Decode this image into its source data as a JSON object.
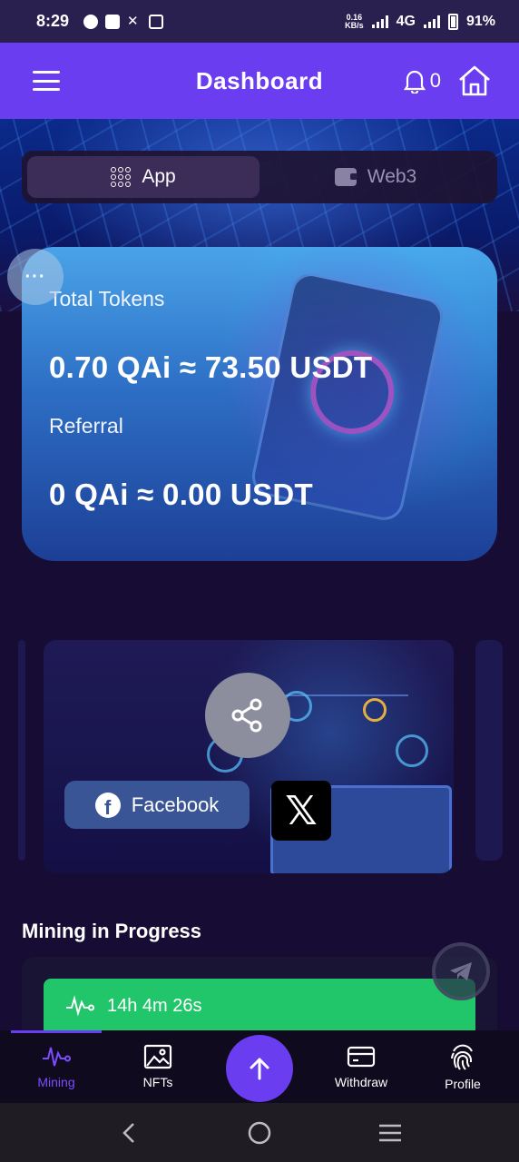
{
  "status_bar": {
    "time": "8:29",
    "net_speed_value": "0.16",
    "net_speed_unit": "KB/s",
    "network": "4G",
    "battery": "91%"
  },
  "app_bar": {
    "title": "Dashboard",
    "notification_count": "0"
  },
  "mode_tabs": [
    {
      "label": "App",
      "icon": "grid-icon",
      "active": true
    },
    {
      "label": "Web3",
      "icon": "wallet-icon",
      "active": false
    }
  ],
  "floating_menu": {
    "label": "···"
  },
  "tokens_card": {
    "total_label": "Total Tokens",
    "total_value": "0.70 QAi ≈ 73.50 USDT",
    "referral_label": "Referral",
    "referral_value": "0 QAi ≈ 0.00 USDT"
  },
  "share_card": {
    "facebook_label": "Facebook",
    "x_label": "𝕏"
  },
  "mining": {
    "title": "Mining in Progress",
    "timer": "14h 4m 26s",
    "accent": "#22c66a"
  },
  "bottom_nav": [
    {
      "label": "Mining",
      "icon": "pulse-icon",
      "active": true
    },
    {
      "label": "NFTs",
      "icon": "image-icon",
      "active": false
    },
    {
      "label": "Withdraw",
      "icon": "card-icon",
      "active": false
    },
    {
      "label": "Profile",
      "icon": "fingerprint-icon",
      "active": false
    }
  ],
  "colors": {
    "primary": "#6a3df0",
    "background": "#170c33",
    "facebook": "#3a5596"
  }
}
